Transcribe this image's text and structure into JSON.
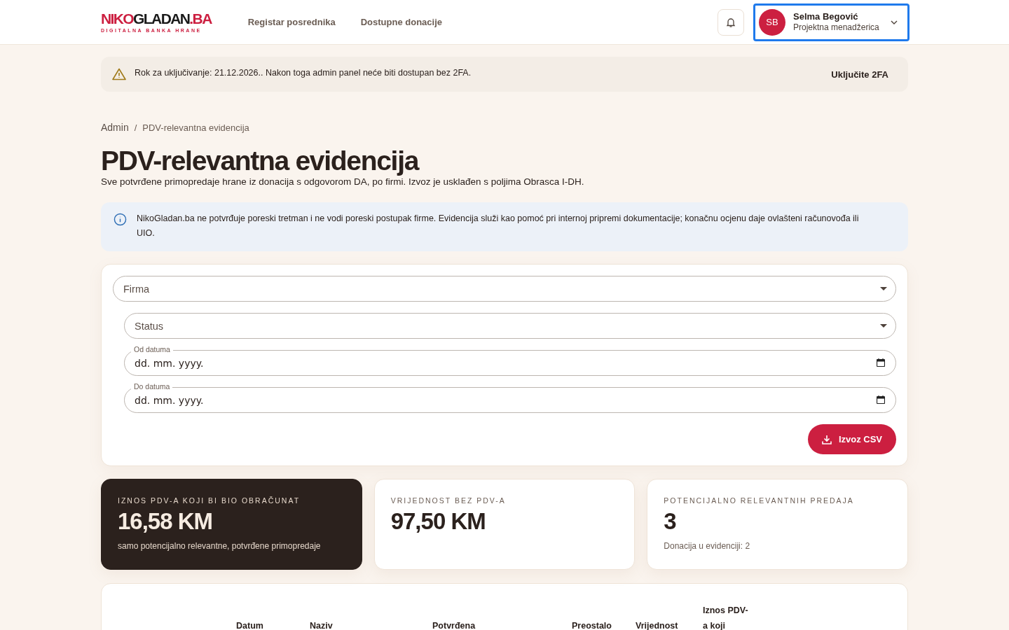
{
  "header": {
    "logo": {
      "parts": [
        {
          "text": "NIKO",
          "color": "#cc1f40"
        },
        {
          "text": "GLADAN",
          "color": "#1a1a1a"
        },
        {
          "text": ".BA",
          "color": "#cc1f40"
        }
      ],
      "tagline": "DIGITALNA BANKA HRANE"
    },
    "nav": [
      "Registar posrednika",
      "Dostupne donacije"
    ],
    "user": {
      "initials": "SB",
      "name": "Selma Begović",
      "role": "Projektna menadžerica"
    }
  },
  "banner": {
    "text": "Rok za uključivanje: 21.12.2026.. Nakon toga admin panel neće biti dostupan bez 2FA.",
    "action": "Uključite 2FA"
  },
  "breadcrumb": {
    "items": [
      "Admin",
      "PDV-relevantna evidencija"
    ],
    "separator": "/"
  },
  "title": "PDV-relevantna evidencija",
  "subtitle": "Sve potvrđene primopredaje hrane iz donacija s odgovorom DA, po firmi. Izvoz je usklađen s poljima Obrasca I-DH.",
  "info": "NikoGladan.ba ne potvrđuje poreski tretman i ne vodi poreski postupak firme. Evidencija služi kao pomoć pri internoj pripremi dokumentacije; konačnu ocjenu daje ovlašteni računovođa ili UIO.",
  "filters": {
    "firm": {
      "placeholder": "Firma"
    },
    "status": {
      "placeholder": "Status"
    },
    "dates": [
      {
        "label": "Od datuma",
        "placeholder": "dd. mm. yyyy."
      },
      {
        "label": "Do datuma",
        "placeholder": "dd. mm. yyyy."
      }
    ],
    "export": "Izvoz CSV"
  },
  "stats": [
    {
      "kind": "dark",
      "label": "IZNOS PDV-A KOJI BI BIO OBRAČUNAT",
      "value": "16,58 KM",
      "note": "samo potencijalno relevantne, potvrđene primopredaje"
    },
    {
      "kind": "light",
      "label": "VRIJEDNOST BEZ PDV-A",
      "value": "97,50 KM"
    },
    {
      "kind": "light",
      "label": "POTENCIJALNO RELEVANTNIH PREDAJA",
      "value": "3",
      "note": "Donacija u evidenciji: 2"
    }
  ],
  "table": {
    "columns": [
      "Datum",
      "Naziv",
      "Potvrđena",
      "Preostalo",
      "Vrijednost",
      "Iznos PDV-a koji"
    ]
  }
}
